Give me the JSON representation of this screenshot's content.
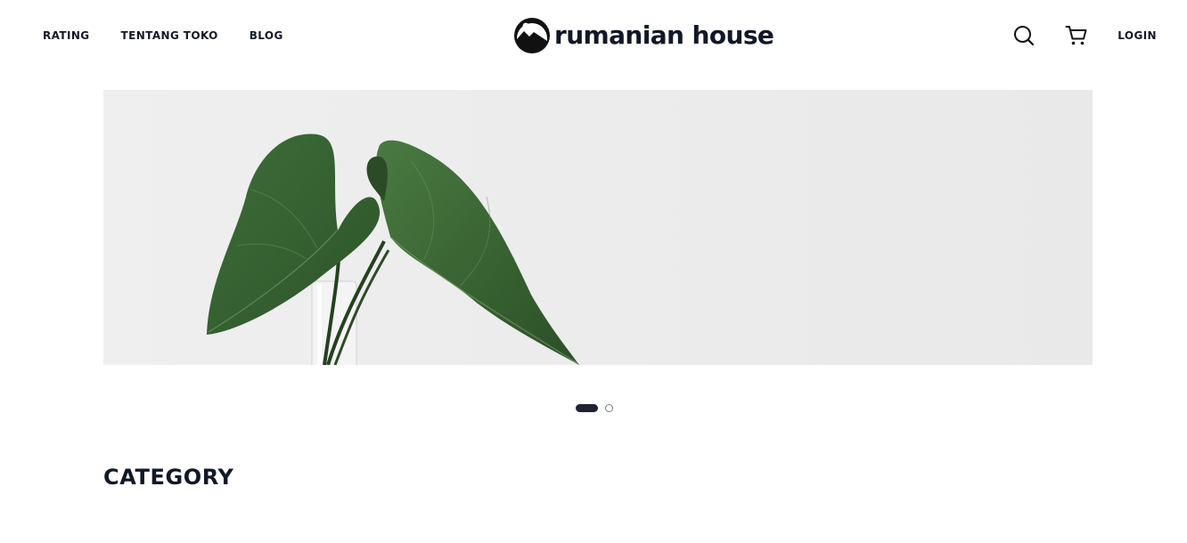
{
  "nav": {
    "left_links": [
      "RATING",
      "TENTANG TOKO",
      "BLOG"
    ],
    "login_label": "LOGIN"
  },
  "brand": {
    "name": "rumanian house"
  },
  "icons": {
    "search": "search-icon",
    "cart": "cart-icon",
    "logo": "logo-mark-icon"
  },
  "carousel": {
    "slide_count": 2,
    "active_index": 0
  },
  "sections": {
    "category_title": "CATEGORY"
  },
  "colors": {
    "text": "#111827",
    "banner_bg": "#ececec",
    "leaf_dark": "#2f5c2c",
    "leaf_light": "#4f7f45",
    "dot_active": "#1f2430",
    "dot_inactive": "#7b7f88"
  }
}
